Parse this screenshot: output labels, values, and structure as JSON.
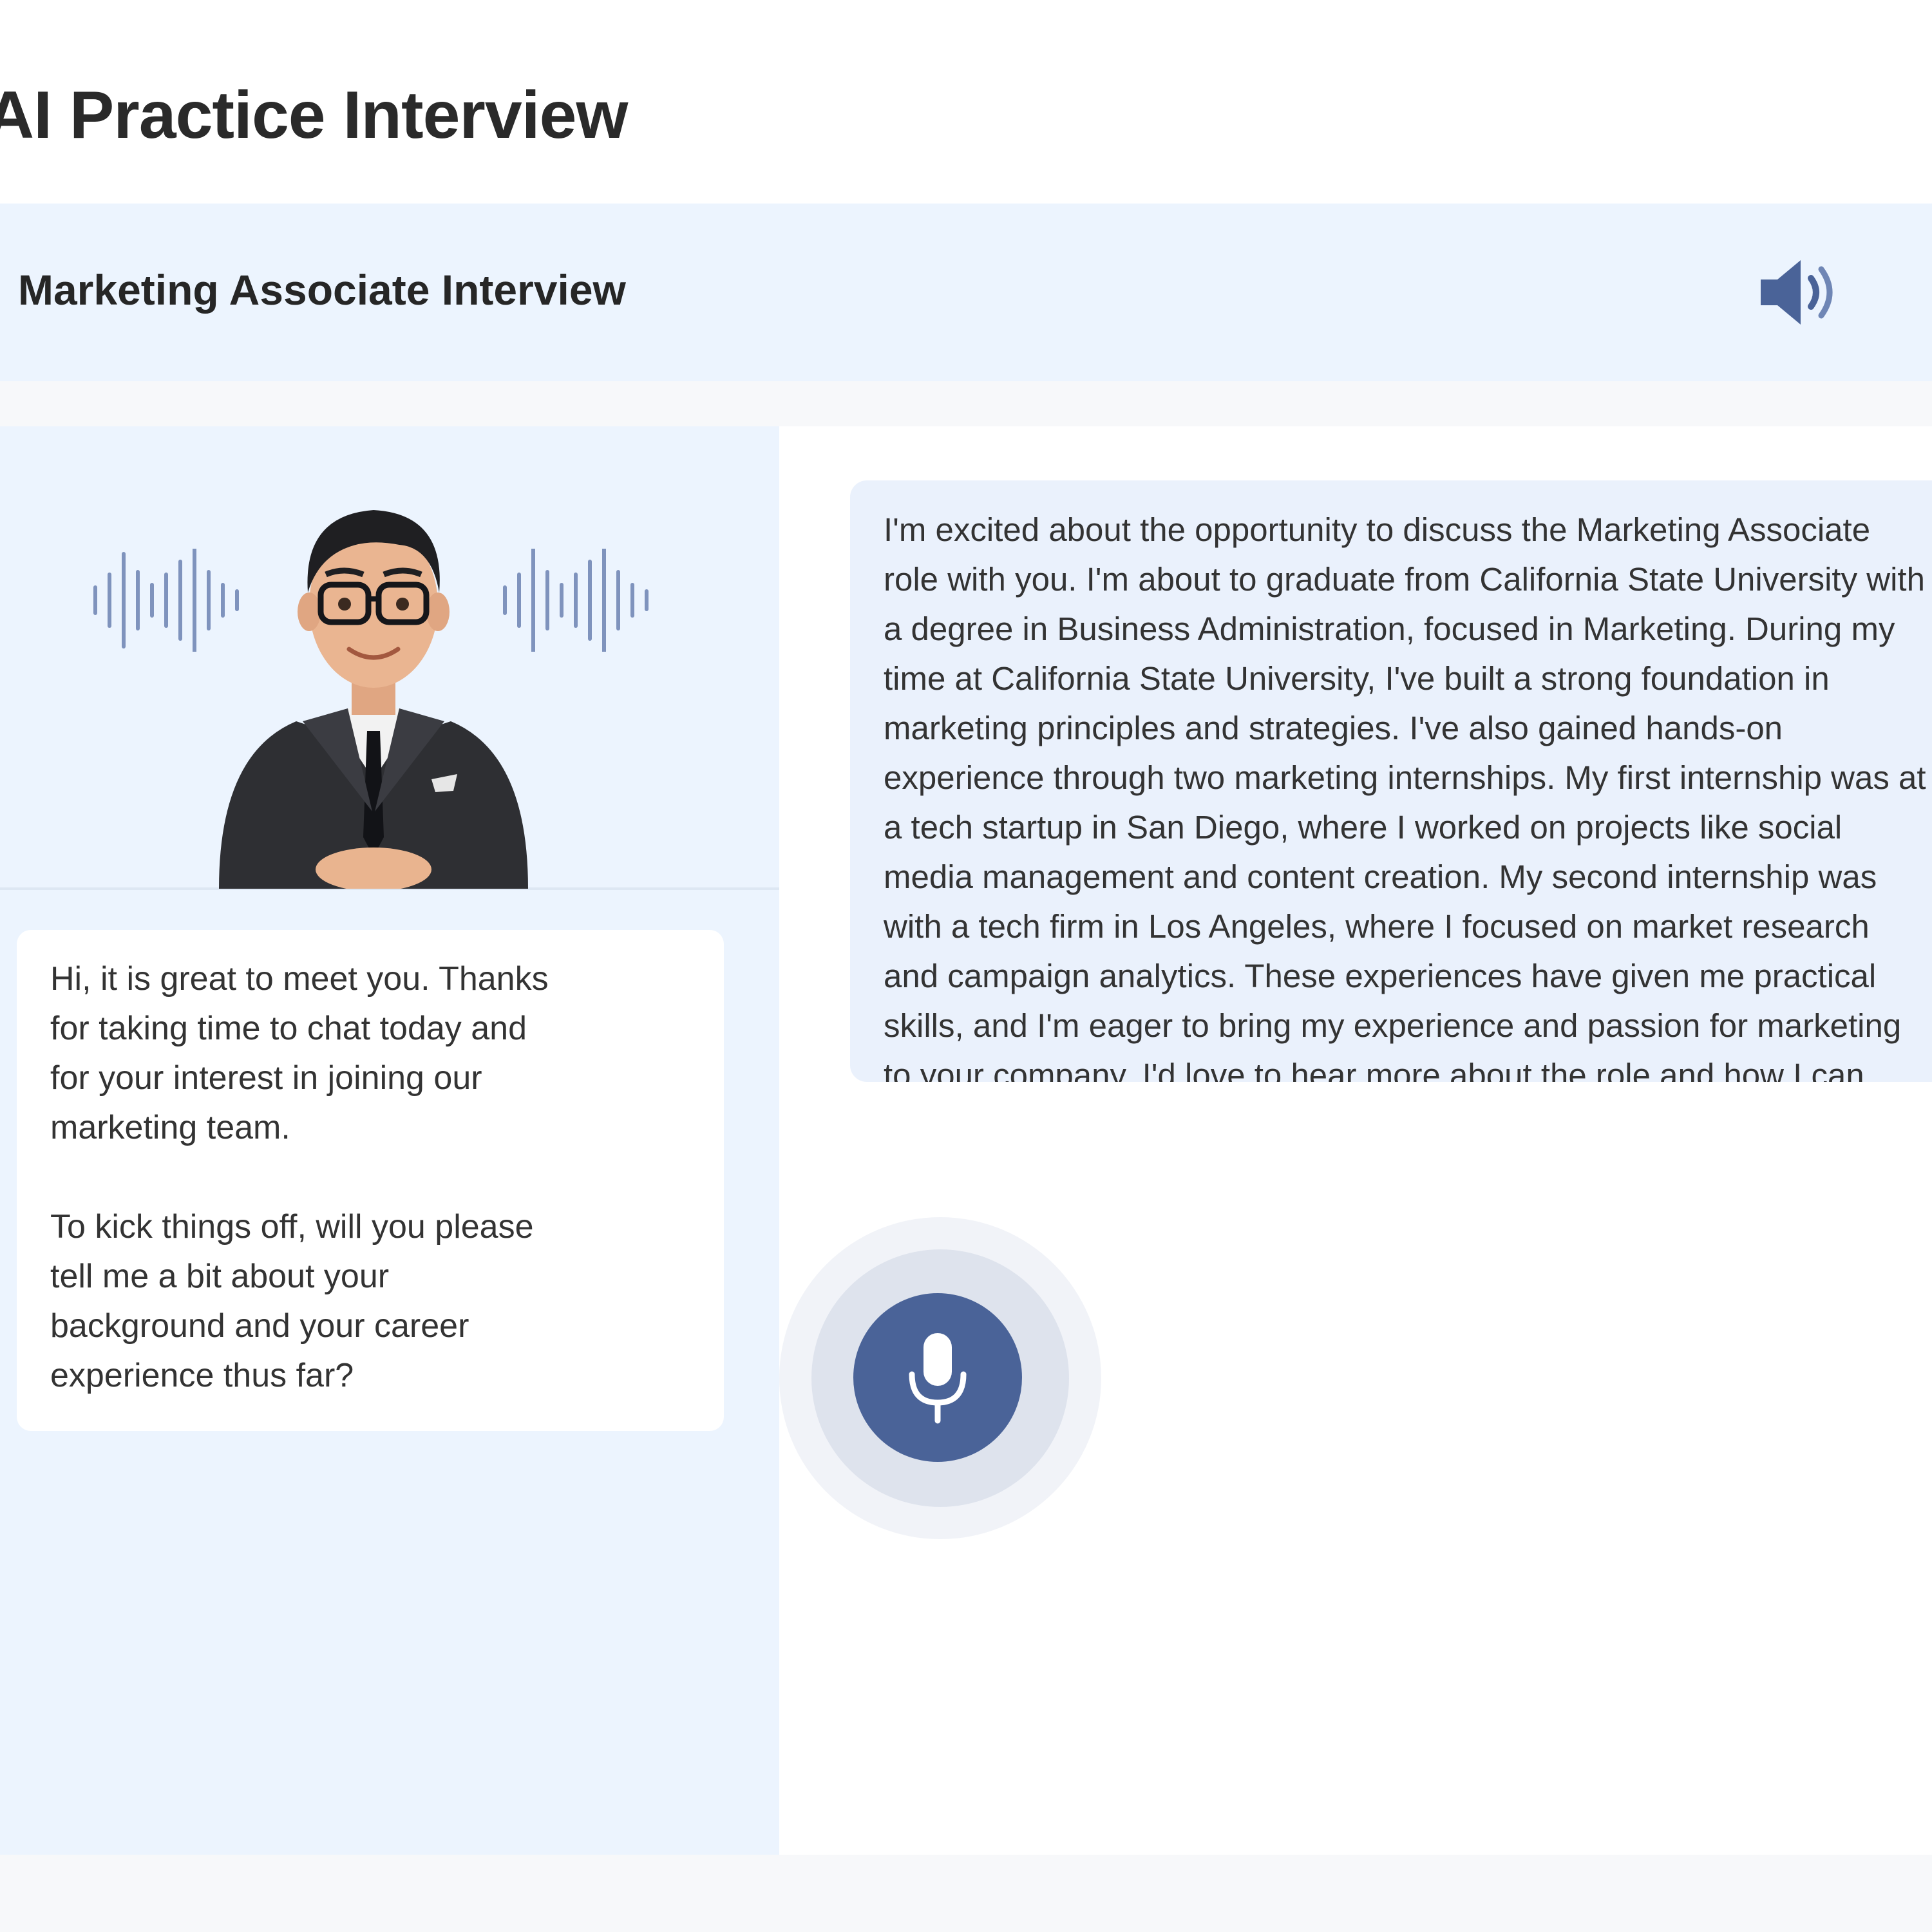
{
  "page": {
    "title": "AI Practice Interview"
  },
  "header": {
    "interview_title": "Marketing Associate Interview",
    "speaker_icon": "speaker-volume-icon"
  },
  "interviewer": {
    "avatar_icon": "interviewer-avatar",
    "wave_icon": "sound-wave-icon",
    "message_paragraphs": [
      "Hi, it is great to meet you. Thanks\nfor taking time to chat today and\nfor your interest in joining our\nmarketing team.",
      "To kick things off, will you please\ntell me a bit about your\nbackground and your career\nexperience thus far?"
    ]
  },
  "candidate": {
    "answer": "I'm excited about the opportunity to discuss the Marketing Associate role with you. I'm about to graduate from California State University with a degree in Business Administration, focused in Marketing. During my time at California State University, I've built a strong foundation in marketing principles and strategies. I've also gained hands-on experience through two marketing internships. My first internship was at a tech startup in San Diego, where I worked on projects like social media management and content creation. My second internship was with a tech firm in Los Angeles, where I focused on market research and campaign analytics. These experiences have given me practical skills, and I'm eager to bring my experience and passion for marketing to your company. I'd love to hear more about the role and how I can align my skills with your team's goals."
  },
  "controls": {
    "mic_icon": "microphone-icon"
  },
  "colors": {
    "accent": "#4a6398",
    "panel_bg": "#ecf4fe",
    "bubble_bg": "#eaf1fc"
  }
}
